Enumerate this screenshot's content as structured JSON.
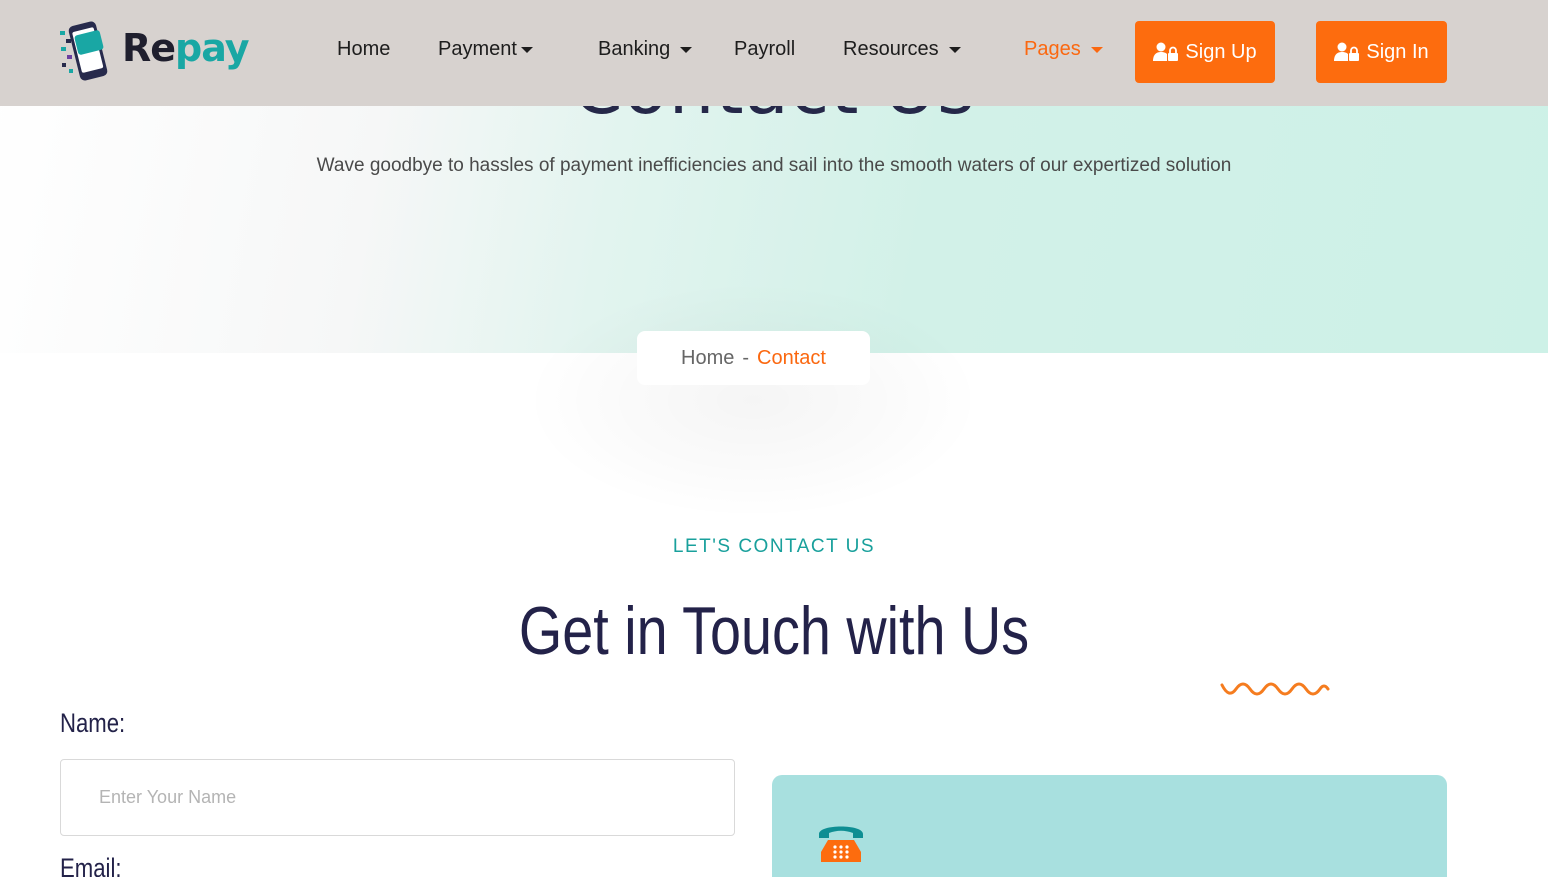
{
  "brand": {
    "re": "Re",
    "pay": "pay"
  },
  "nav": {
    "items": [
      {
        "label": "Home",
        "dropdown": false
      },
      {
        "label": "Payment",
        "dropdown": true
      },
      {
        "label": "Banking",
        "dropdown": true
      },
      {
        "label": "Payroll",
        "dropdown": false
      },
      {
        "label": "Resources",
        "dropdown": true
      },
      {
        "label": "Pages",
        "dropdown": true,
        "active": true
      }
    ],
    "sign_up": "Sign Up",
    "sign_in": "Sign In",
    "button_icon": "user-lock-icon"
  },
  "hero": {
    "title": "Contact Us",
    "subtitle": "Wave goodbye to hassles of payment inefficiencies and sail into the smooth waters of our expertized solution"
  },
  "breadcrumb": {
    "home": "Home",
    "separator": "-",
    "current": "Contact"
  },
  "section": {
    "eyebrow": "LET'S CONTACT US",
    "title": "Get in Touch with Us"
  },
  "form": {
    "name_label": "Name:",
    "name_placeholder": "Enter Your Name",
    "email_label": "Email:"
  },
  "info_card": {
    "icon": "phone-icon"
  },
  "colors": {
    "accent": "#fd6c0e",
    "teal": "#19a7a4",
    "header_bg": "#d7d2cf",
    "card_bg": "#a8e0df",
    "heading": "#232249"
  }
}
